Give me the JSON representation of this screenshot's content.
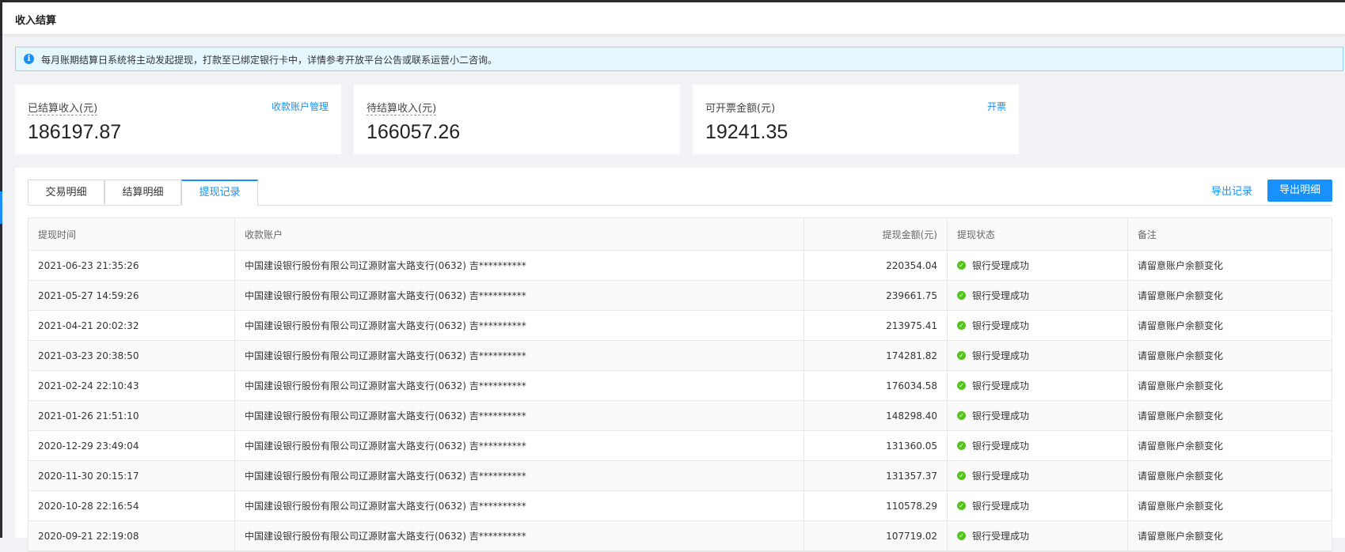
{
  "header": {
    "title": "收入结算"
  },
  "notice": {
    "text": "每月账期结算日系统将主动发起提现，打款至已绑定银行卡中，详情参考开放平台公告或联系运营小二咨询。"
  },
  "cards": [
    {
      "label": "已结算收入(元)",
      "value": "186197.87",
      "link": "收款账户管理"
    },
    {
      "label": "待结算收入(元)",
      "value": "166057.26"
    },
    {
      "label": "可开票金额(元)",
      "value": "19241.35",
      "link": "开票"
    }
  ],
  "tabs": [
    "交易明细",
    "结算明细",
    "提现记录"
  ],
  "actions": {
    "export_records": "导出记录",
    "export_details": "导出明细"
  },
  "table": {
    "columns": [
      "提现时间",
      "收款账户",
      "提现金额(元)",
      "提现状态",
      "备注"
    ],
    "rows": [
      {
        "time": "2021-06-23 21:35:26",
        "account": "中国建设银行股份有限公司辽源财富大路支行(0632) 吉**********",
        "amount": "220354.04",
        "status": "银行受理成功",
        "note": "请留意账户余额变化"
      },
      {
        "time": "2021-05-27 14:59:26",
        "account": "中国建设银行股份有限公司辽源财富大路支行(0632) 吉**********",
        "amount": "239661.75",
        "status": "银行受理成功",
        "note": "请留意账户余额变化"
      },
      {
        "time": "2021-04-21 20:02:32",
        "account": "中国建设银行股份有限公司辽源财富大路支行(0632) 吉**********",
        "amount": "213975.41",
        "status": "银行受理成功",
        "note": "请留意账户余额变化"
      },
      {
        "time": "2021-03-23 20:38:50",
        "account": "中国建设银行股份有限公司辽源财富大路支行(0632) 吉**********",
        "amount": "174281.82",
        "status": "银行受理成功",
        "note": "请留意账户余额变化"
      },
      {
        "time": "2021-02-24 22:10:43",
        "account": "中国建设银行股份有限公司辽源财富大路支行(0632) 吉**********",
        "amount": "176034.58",
        "status": "银行受理成功",
        "note": "请留意账户余额变化"
      },
      {
        "time": "2021-01-26 21:51:10",
        "account": "中国建设银行股份有限公司辽源财富大路支行(0632) 吉**********",
        "amount": "148298.40",
        "status": "银行受理成功",
        "note": "请留意账户余额变化"
      },
      {
        "time": "2020-12-29 23:49:04",
        "account": "中国建设银行股份有限公司辽源财富大路支行(0632) 吉**********",
        "amount": "131360.05",
        "status": "银行受理成功",
        "note": "请留意账户余额变化"
      },
      {
        "time": "2020-11-30 20:15:17",
        "account": "中国建设银行股份有限公司辽源财富大路支行(0632) 吉**********",
        "amount": "131357.37",
        "status": "银行受理成功",
        "note": "请留意账户余额变化"
      },
      {
        "time": "2020-10-28 22:16:54",
        "account": "中国建设银行股份有限公司辽源财富大路支行(0632) 吉**********",
        "amount": "110578.29",
        "status": "银行受理成功",
        "note": "请留意账户余额变化"
      },
      {
        "time": "2020-09-21 22:19:08",
        "account": "中国建设银行股份有限公司辽源财富大路支行(0632) 吉**********",
        "amount": "107719.02",
        "status": "银行受理成功",
        "note": "请留意账户余额变化"
      }
    ]
  }
}
